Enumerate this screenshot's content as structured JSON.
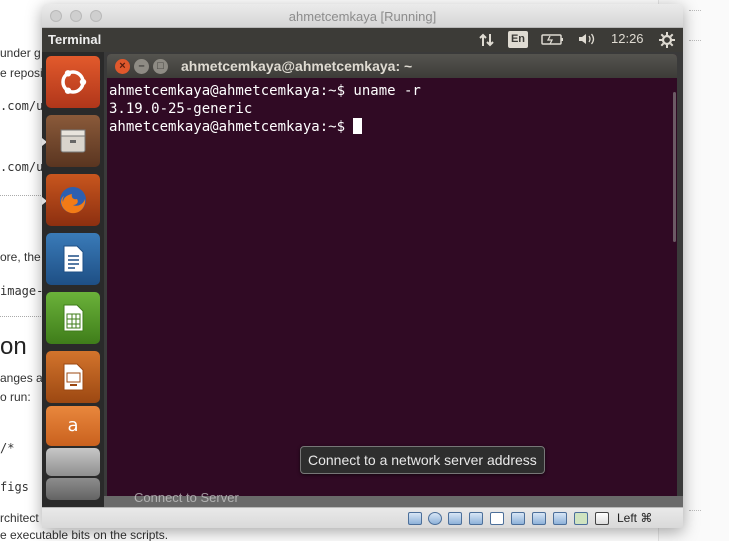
{
  "background_page": {
    "lines": [
      {
        "text": "under g",
        "mono": false
      },
      {
        "text": "e reposi",
        "mono": false
      },
      {
        "text": ".com/u",
        "mono": true
      },
      {
        "text": ".com/u",
        "mono": true
      },
      {
        "text": "ore, the",
        "mono": false
      },
      {
        "text": "image-",
        "mono": true
      },
      {
        "text": "on",
        "heading": true
      },
      {
        "text": "anges a",
        "mono": false
      },
      {
        "text": "o run:",
        "mono": false
      },
      {
        "text": "/*",
        "mono": true
      },
      {
        "text": "figs",
        "mono": true
      },
      {
        "text": "rchitect",
        "mono": false
      },
      {
        "text": "e executable bits on the scripts.",
        "mono": false
      }
    ]
  },
  "vbox": {
    "title": "ahmetcemkaya [Running]",
    "host_key": "Left ⌘"
  },
  "topbar": {
    "app_name": "Terminal",
    "keyboard_layout": "En",
    "clock": "12:26",
    "icons": [
      "transfer-arrows-icon",
      "battery-icon",
      "volume-icon",
      "gear-icon"
    ]
  },
  "launcher": {
    "items": [
      {
        "name": "ubuntu-dash-icon",
        "running": false
      },
      {
        "name": "files-icon",
        "running": true
      },
      {
        "name": "firefox-icon",
        "running": true
      },
      {
        "name": "libreoffice-writer-icon",
        "running": false
      },
      {
        "name": "libreoffice-calc-icon",
        "running": false
      },
      {
        "name": "libreoffice-impress-icon",
        "running": false
      },
      {
        "name": "amazon-icon",
        "running": false
      }
    ]
  },
  "terminal": {
    "title": "ahmetcemkaya@ahmetcemkaya: ~",
    "lines": [
      "ahmetcemkaya@ahmetcemkaya:~$ uname -r",
      "3.19.0-25-generic",
      "ahmetcemkaya@ahmetcemkaya:~$ "
    ]
  },
  "desktop": {
    "ghost_label": "Connect to Server"
  },
  "tooltip": {
    "text": "Connect to a network server address"
  },
  "colors": {
    "terminal_bg": "#300a24",
    "topbar_bg": "#3c3b37",
    "close_button": "#e0582c"
  }
}
